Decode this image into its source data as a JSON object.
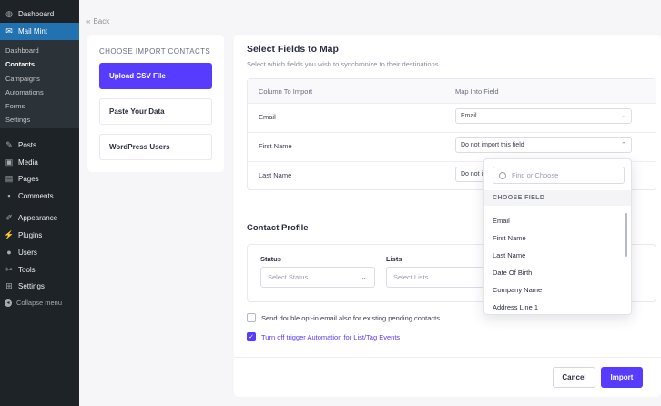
{
  "wp_menu": {
    "dashboard": "Dashboard",
    "mail_mint": "Mail Mint",
    "submenu": [
      "Dashboard",
      "Contacts",
      "Campaigns",
      "Automations",
      "Forms",
      "Settings"
    ],
    "posts": "Posts",
    "media": "Media",
    "pages": "Pages",
    "comments": "Comments",
    "appearance": "Appearance",
    "plugins": "Plugins",
    "users": "Users",
    "tools": "Tools",
    "settings": "Settings",
    "collapse": "Collapse menu"
  },
  "back_label": "Back",
  "import_options": {
    "header": "CHOOSE IMPORT CONTACTS",
    "items": [
      "Upload CSV File",
      "Paste Your Data",
      "WordPress Users"
    ]
  },
  "mapping": {
    "title": "Select Fields to Map",
    "subtitle": "Select which fields you wish to synchronize to their destinations.",
    "col_import": "Column To Import",
    "col_map": "Map Into Field",
    "rows": [
      {
        "label": "Email",
        "value": "Email"
      },
      {
        "label": "First Name",
        "value": "Do not import this field"
      },
      {
        "label": "Last Name",
        "value": "Do not i"
      }
    ]
  },
  "dropdown": {
    "search_placeholder": "Find or Choose",
    "header": "CHOOSE FIELD",
    "items": [
      "Email",
      "First Name",
      "Last Name",
      "Date Of Birth",
      "Company Name",
      "Address Line 1"
    ]
  },
  "contact_profile": {
    "title": "Contact Profile",
    "status_label": "Status",
    "status_placeholder": "Select Status",
    "lists_label": "Lists",
    "lists_placeholder": "Select Lists"
  },
  "options": {
    "double_optin": "Send double opt-in email also for existing pending contacts",
    "double_optin_checked": false,
    "turn_off_automation": "Turn off trigger Automation for List/Tag Events",
    "turn_off_automation_checked": true
  },
  "buttons": {
    "cancel": "Cancel",
    "import": "Import"
  },
  "colors": {
    "accent": "#573bff",
    "wp_sidebar": "#1d2327",
    "wp_active": "#2271b1"
  }
}
